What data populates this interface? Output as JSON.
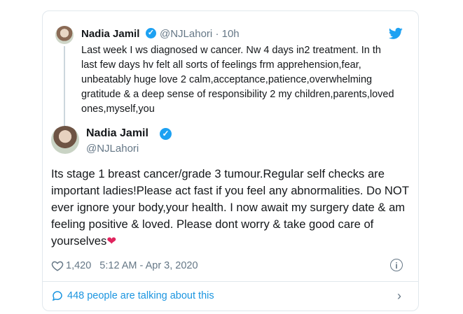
{
  "quoted_tweet": {
    "name": "Nadia Jamil",
    "handle": "@NJLahori",
    "time": "· 10h",
    "text": "Last week I ws diagnosed w cancer. Nw 4 days in2 treatment. In th last few days hv felt all sorts of feelings frm apprehension,fear, unbeatably huge love 2 calm,acceptance,patience,overwhelming gratitude & a deep sense of responsibility 2 my children,parents,loved ones,myself,you"
  },
  "main_tweet": {
    "name": "Nadia Jamil",
    "handle": "@NJLahori",
    "text": "Its stage 1 breast cancer/grade 3 tumour.Regular self checks are important ladies!Please act fast if you feel any abnormalities. Do NOT ever ignore your body,your health. I now await my surgery date & am feeling positive & loved. Please dont worry & take good care of yourselves",
    "emoji": "❤",
    "likes": "1,420",
    "timestamp": "5:12 AM - Apr 3, 2020"
  },
  "footer": {
    "talking_label": "448 people are talking about this"
  },
  "icons": {
    "verified": "verified-badge-icon",
    "brand": "twitter-bird-icon",
    "like": "heart-outline-icon",
    "info": "info-icon",
    "reply": "speech-bubble-icon",
    "next": "chevron-right-icon"
  },
  "colors": {
    "accent": "#1da1f2",
    "link": "#1b95e0",
    "muted": "#657786",
    "heart": "#e0245e"
  }
}
